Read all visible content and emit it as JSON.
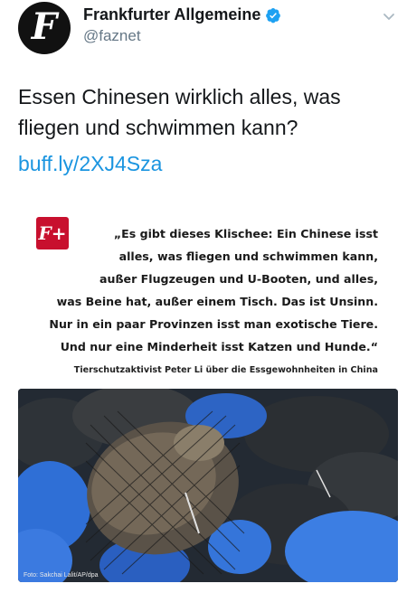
{
  "account": {
    "display_name": "Frankfurter Allgemeine",
    "handle": "@faznet",
    "avatar_letter": "F",
    "verified": true
  },
  "tweet": {
    "text": "Essen Chinesen wirklich alles, was fliegen und schwimmen kann?",
    "link": "buff.ly/2XJ4Sza"
  },
  "card": {
    "logo_text": "F+",
    "quote_lines": [
      "„Es gibt dieses Klischee: Ein Chinese isst",
      "alles, was fliegen und schwimmen kann,",
      "außer Flugzeugen und U-Booten, und alles,",
      "was Beine hat, außer einem Tisch. Das ist Unsinn.",
      "Nur in ein paar Provinzen isst man exotische Tiere.",
      "Und nur eine Minderheit isst Katzen und Hunde.“"
    ],
    "caption": "Tierschutzaktivist Peter Li über die Essgewohnheiten in China",
    "photo_credit": "Foto: Sakchai Lalit/AP/dpa"
  },
  "colors": {
    "verified": "#1da1f2",
    "link": "#1b95e0",
    "brand_red": "#c8102e"
  },
  "icons": [
    "verified-badge-icon",
    "chevron-down-icon"
  ]
}
